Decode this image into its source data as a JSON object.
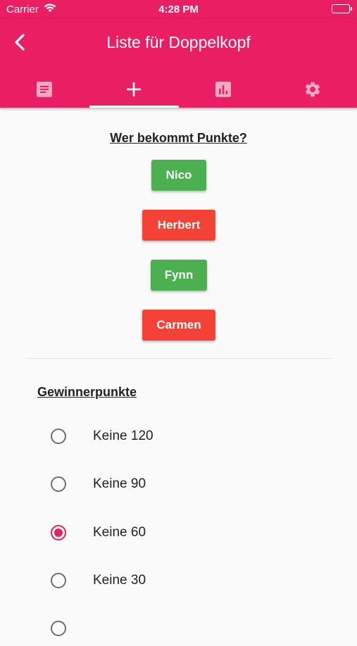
{
  "status_bar": {
    "carrier": "Carrier",
    "time": "4:28 PM"
  },
  "app_bar": {
    "title": "Liste für Doppelkopf"
  },
  "tabs": [
    {
      "name": "list",
      "icon": "list-icon"
    },
    {
      "name": "add",
      "icon": "add-icon",
      "active": true
    },
    {
      "name": "stats",
      "icon": "chart-icon"
    },
    {
      "name": "settings",
      "icon": "gear-icon"
    }
  ],
  "colors": {
    "accent": "#e91e63",
    "green": "#4caf50",
    "red": "#f44336"
  },
  "players_section": {
    "heading": "Wer bekommt Punkte?",
    "players": [
      {
        "name": "Nico",
        "selected": true
      },
      {
        "name": "Herbert",
        "selected": false
      },
      {
        "name": "Fynn",
        "selected": true
      },
      {
        "name": "Carmen",
        "selected": false
      }
    ]
  },
  "winner_section": {
    "heading": "Gewinnerpunkte",
    "options": [
      {
        "label": "Keine 120",
        "checked": false
      },
      {
        "label": "Keine 90",
        "checked": false
      },
      {
        "label": "Keine 60",
        "checked": true
      },
      {
        "label": "Keine 30",
        "checked": false
      }
    ]
  }
}
